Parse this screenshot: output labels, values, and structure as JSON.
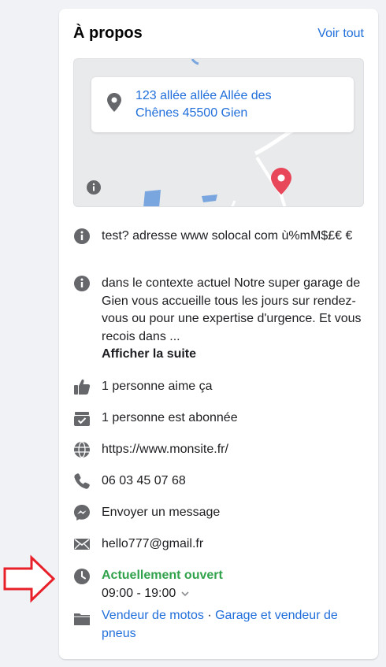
{
  "about": {
    "title": "À propos",
    "see_all": "Voir tout"
  },
  "map": {
    "address_line1": "123 allée allée Allée des",
    "address_line2": "Chênes 45500 Gien"
  },
  "details": {
    "info1": "test? adresse www solocal com ù%mM$£€ €",
    "info2": "dans le contexte actuel Notre super garage de Gien vous accueille tous les jours sur rendez-vous ou pour une expertise d'urgence. Et vous recois dans ...",
    "info2_more": "Afficher la suite",
    "likes": "1 personne aime ça",
    "followers": "1 personne est abonnée",
    "website": "https://www.monsite.fr/",
    "phone": "06 03 45 07 68",
    "message": "Envoyer un message",
    "email": "hello777@gmail.fr",
    "open_status": "Actuellement ouvert",
    "hours": "09:00 - 19:00",
    "category1": "Vendeur de motos",
    "category_sep": " · ",
    "category2": "Garage et vendeur de pneus"
  },
  "icons": {
    "location": "location-pin-icon",
    "info": "info-icon",
    "like": "thumbs-up-icon",
    "follow": "follow-check-icon",
    "globe": "globe-icon",
    "phone": "phone-icon",
    "messenger": "messenger-icon",
    "email": "envelope-icon",
    "clock": "clock-icon",
    "category": "category-icon",
    "annotation": "red-arrow-icon"
  },
  "colors": {
    "link": "#216fdb",
    "open": "#31a24c",
    "icon": "#65676b",
    "pin": "#e8475a",
    "arrow": "#e8202a"
  }
}
